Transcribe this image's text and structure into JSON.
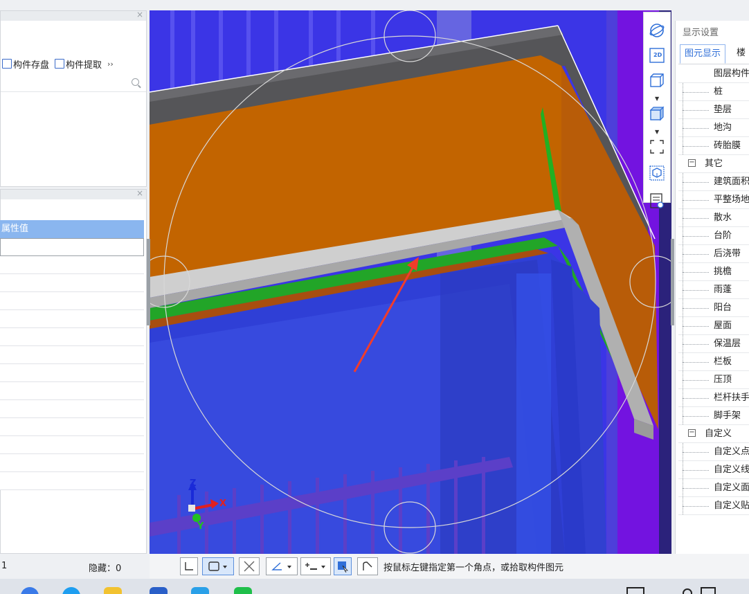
{
  "left_top_panel": {
    "close": "×",
    "toolbar": {
      "save_label": "构件存盘",
      "extract_label": "构件提取",
      "more_label": "››"
    },
    "search_placeholder": ""
  },
  "left_prop_panel": {
    "close": "×",
    "column_header": "属性值",
    "rows": [
      "",
      "",
      "",
      "",
      "",
      "",
      "",
      "",
      "",
      "",
      "",
      "",
      "",
      ""
    ]
  },
  "status_left": {
    "count": "1",
    "hidden_label": "隐藏：0"
  },
  "right_panel": {
    "title": "显示设置",
    "tabs": [
      {
        "label": "图元显示"
      },
      {
        "label": "楼"
      }
    ],
    "tree": [
      {
        "label": "图层构件",
        "type": "header"
      },
      {
        "label": "桩",
        "type": "item"
      },
      {
        "label": "垫层",
        "type": "item"
      },
      {
        "label": "地沟",
        "type": "item"
      },
      {
        "label": "砖胎膜",
        "type": "item"
      },
      {
        "label": "其它",
        "type": "group",
        "expander": "−"
      },
      {
        "label": "建筑面积",
        "type": "item"
      },
      {
        "label": "平整场地",
        "type": "item"
      },
      {
        "label": "散水",
        "type": "item"
      },
      {
        "label": "台阶",
        "type": "item"
      },
      {
        "label": "后浇带",
        "type": "item"
      },
      {
        "label": "挑檐",
        "type": "item"
      },
      {
        "label": "雨蓬",
        "type": "item"
      },
      {
        "label": "阳台",
        "type": "item"
      },
      {
        "label": "屋面",
        "type": "item"
      },
      {
        "label": "保温层",
        "type": "item"
      },
      {
        "label": "栏板",
        "type": "item"
      },
      {
        "label": "压顶",
        "type": "item"
      },
      {
        "label": "栏杆扶手",
        "type": "item"
      },
      {
        "label": "脚手架",
        "type": "item"
      },
      {
        "label": "自定义",
        "type": "group",
        "expander": "−"
      },
      {
        "label": "自定义点",
        "type": "item"
      },
      {
        "label": "自定义线",
        "type": "item"
      },
      {
        "label": "自定义面",
        "type": "item"
      },
      {
        "label": "自定义贴",
        "type": "item"
      }
    ]
  },
  "view_toolbar": {
    "icons": [
      "orbit-icon",
      "2d-view-icon",
      "3d-box-icon",
      "shaded-box-icon",
      "fit-extents-icon",
      "view-cube-icon",
      "display-settings-icon"
    ],
    "label_2d": "2D"
  },
  "axis": {
    "x": "X",
    "y": "Y",
    "z": "Z"
  },
  "bottom_bar": {
    "hint": "按鼠标左键指定第一个角点，或拾取构件图元"
  },
  "colors": {
    "accent": "#2f6fd8",
    "header_blue": "#8ab6ef",
    "beam_orange": "#c26400",
    "slab_gray": "#bdbdbd",
    "wall_blue": "#3a3ae8",
    "arrow_red": "#f23c2a"
  }
}
